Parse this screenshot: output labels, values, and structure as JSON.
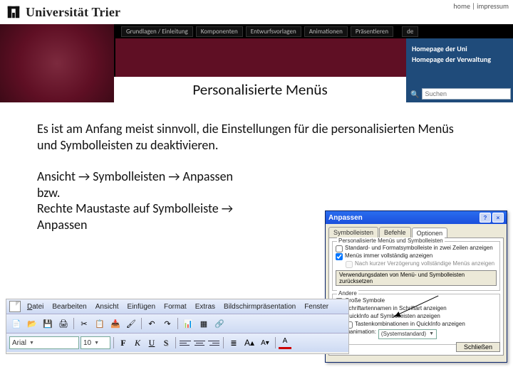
{
  "top_links": {
    "home": "home",
    "sep": " | ",
    "impressum": "impressum"
  },
  "logo_text": "Universität Trier",
  "nav_tabs": [
    "Grundlagen / Einleitung",
    "Komponenten",
    "Entwurfsvorlagen",
    "Animationen",
    "Präsentieren"
  ],
  "lang": "de",
  "side": {
    "l1": "Homepage der Uni",
    "l2": "Homepage der Verwaltung",
    "search_placeholder": "Suchen"
  },
  "page_title": "Personalisierte Menüs",
  "body": {
    "p1": "Es ist am Anfang meist sinnvoll, die Einstellungen für die personalisierten Menüs und Symbolleisten zu deaktivieren.",
    "path_1a": "Ansicht",
    "path_1b": "Symbolleisten",
    "path_1c": "Anpassen",
    "bzw": "bzw.",
    "path_2a": "Rechte Maustaste auf Symbolleiste",
    "path_2b": "Anpassen",
    "arrow": "→"
  },
  "dialog": {
    "title": "Anpassen",
    "tabs": [
      "Symbolleisten",
      "Befehle",
      "Optionen"
    ],
    "grp1_title": "Personalisierte Menüs und Symbolleisten",
    "chk1": "Standard- und Formatsymbolleiste in zwei Zeilen anzeigen",
    "chk2": "Menüs immer vollständig anzeigen",
    "chk2a": "Nach kurzer Verzögerung vollständige Menüs anzeigen",
    "reset": "Verwendungsdaten von Menü- und Symbolleisten zurücksetzen",
    "grp2_title": "Andere",
    "o1": "Große Symbole",
    "o2": "Schriftartennamen in Schriftart anzeigen",
    "o3": "QuickInfo auf Symbolleisten anzeigen",
    "o4": "Tastenkombinationen in QuickInfo anzeigen",
    "anim_lbl": "Menüanimation:",
    "anim_val": "(Systemstandard)",
    "close": "Schließen"
  },
  "menu": {
    "datei": "Datei",
    "bearbeiten": "Bearbeiten",
    "ansicht": "Ansicht",
    "einfuegen": "Einfügen",
    "format": "Format",
    "extras": "Extras",
    "bild": "Bildschirmpräsentation",
    "fenster": "Fenster"
  },
  "fmt": {
    "font": "Arial",
    "size": "10",
    "b": "F",
    "i": "K",
    "u": "U",
    "s": "S"
  }
}
